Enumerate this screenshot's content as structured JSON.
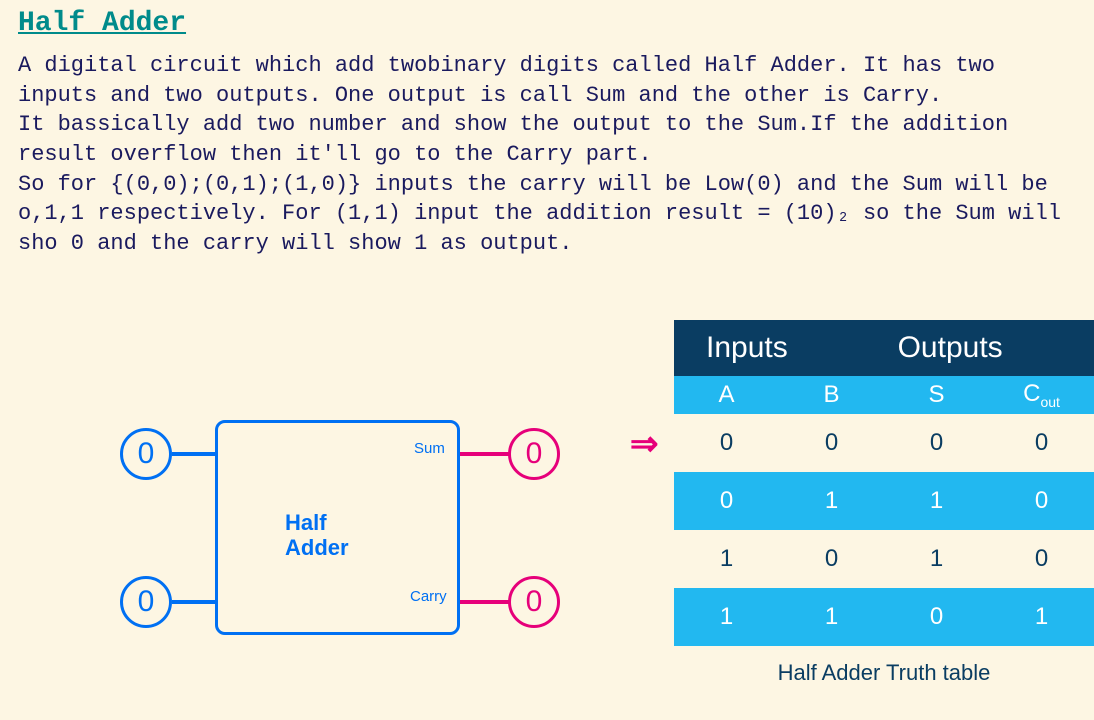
{
  "title": "Half Adder",
  "paragraph": "A digital circuit which add twobinary digits called Half Adder. It has two inputs and two outputs. One output is call Sum and the other is Carry.\nIt bassically add two number and show the output to the Sum.If the addition result overflow then it'll go to the Carry part.\nSo for {(0,0);(0,1);(1,0)} inputs the carry will be Low(0) and the Sum will be o,1,1 respectively. For (1,1) input the addition result = (10)₂ so the Sum will sho 0 and the carry will show 1 as output.",
  "circuit": {
    "block_label_line1": "Half",
    "block_label_line2": "Adder",
    "in1": "0",
    "in2": "0",
    "out1": "0",
    "out2": "0",
    "out1_label": "Sum",
    "out2_label": "Carry"
  },
  "truth_table": {
    "header_inputs": "Inputs",
    "header_outputs": "Outputs",
    "col_a": "A",
    "col_b": "B",
    "col_s": "S",
    "col_cout": "C",
    "col_cout_sub": "out",
    "rows": [
      {
        "a": "0",
        "b": "0",
        "s": "0",
        "c": "0"
      },
      {
        "a": "0",
        "b": "1",
        "s": "1",
        "c": "0"
      },
      {
        "a": "1",
        "b": "0",
        "s": "1",
        "c": "0"
      },
      {
        "a": "1",
        "b": "1",
        "s": "0",
        "c": "1"
      }
    ],
    "caption": "Half Adder Truth table",
    "current_row_indicator": "⇒"
  },
  "chart_data": {
    "type": "table",
    "title": "Half Adder Truth table",
    "columns": [
      "A",
      "B",
      "S",
      "Cout"
    ],
    "rows": [
      [
        0,
        0,
        0,
        0
      ],
      [
        0,
        1,
        1,
        0
      ],
      [
        1,
        0,
        1,
        0
      ],
      [
        1,
        1,
        0,
        1
      ]
    ],
    "highlighted_row_index": 0
  }
}
